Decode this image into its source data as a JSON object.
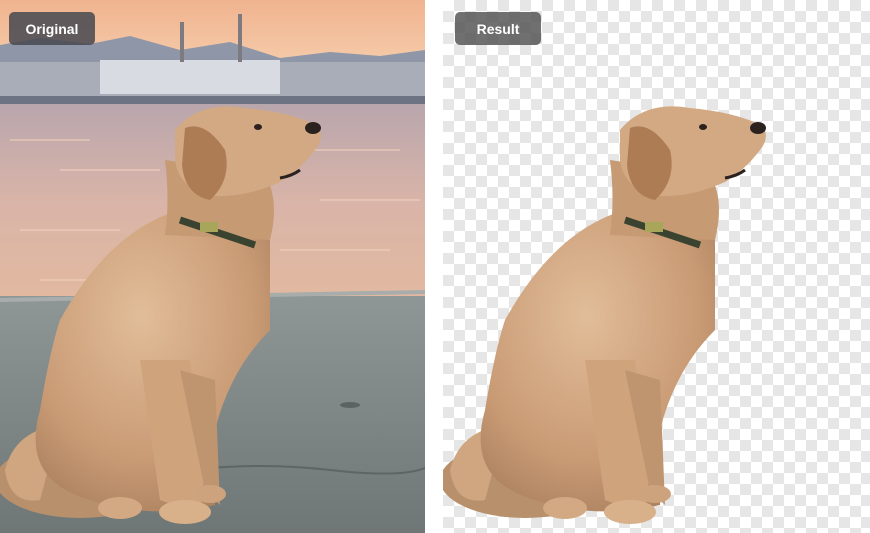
{
  "comparison": {
    "original_label": "Original",
    "result_label": "Result"
  },
  "images": {
    "original": "golden-retriever-sitting-by-harbor-photo",
    "result": "golden-retriever-cutout-on-transparent-background"
  },
  "colors": {
    "badge_bg": "#464850",
    "badge_text": "#ffffff",
    "checker_light": "#ffffff",
    "checker_dark": "#e6e6e6",
    "dog_fur": "#c79a73"
  }
}
